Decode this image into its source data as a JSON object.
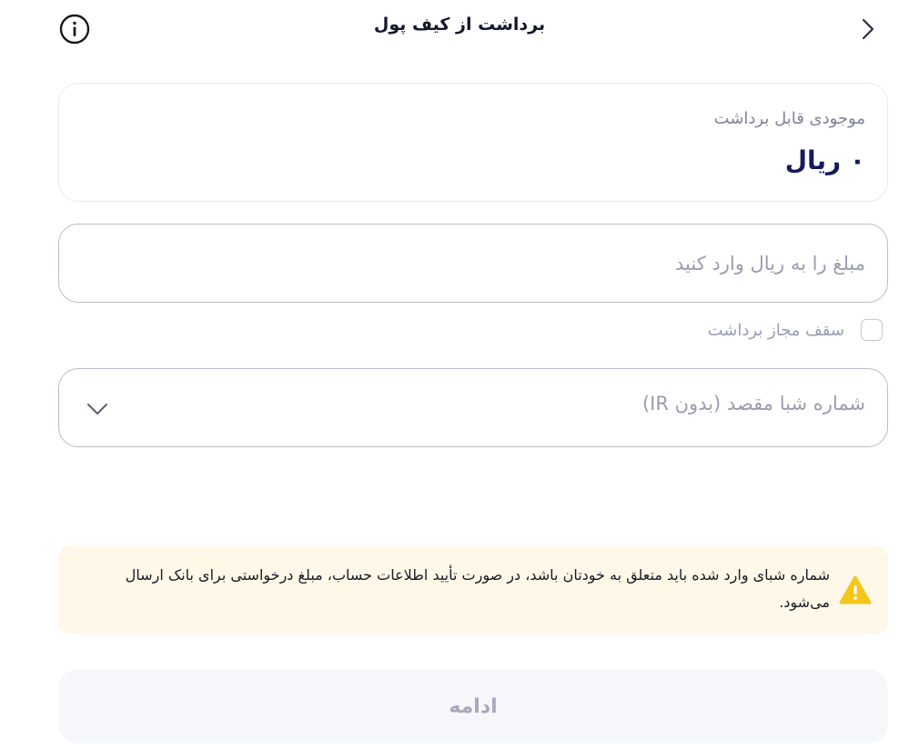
{
  "header": {
    "title": "برداشت از کیف پول",
    "back_icon": "chevron-right-icon",
    "info_icon": "info-icon"
  },
  "balance": {
    "label": "موجودی قابل برداشت",
    "value": "۰ ریال"
  },
  "amount": {
    "placeholder": "مبلغ را به ریال وارد کنید",
    "value": ""
  },
  "limit": {
    "label": "سقف مجاز برداشت",
    "checked": false
  },
  "iban": {
    "placeholder": "شماره شبا مقصد (بدون IR)",
    "icon": "chevron-down-icon"
  },
  "warning": {
    "icon": "warning-icon",
    "color": "#f5c518",
    "background": "#fff8e8",
    "text": "شماره شبای وارد شده باید متعلق به خودتان باشد، در صورت تأیید اطلاعات حساب، مبلغ درخواستی برای بانک ارسال می‌شود."
  },
  "actions": {
    "continue_label": "ادامه"
  },
  "colors": {
    "balance_value": "#141a5c",
    "muted_text": "#9a9db0",
    "border": "#b9bccb"
  }
}
